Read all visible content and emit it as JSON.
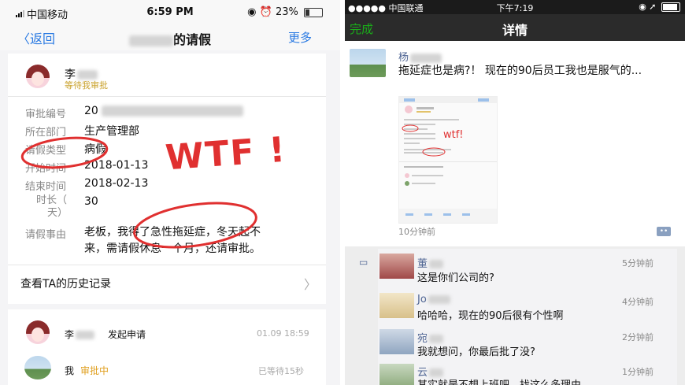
{
  "left": {
    "status": {
      "carrier": "中国移动",
      "time": "6:59 PM",
      "battery": "23%",
      "battery_level": 0.23
    },
    "nav": {
      "back_label": "返回",
      "title_suffix": "的请假",
      "more_label": "更多"
    },
    "applicant": {
      "name": "李",
      "status": "等待我审批"
    },
    "fields": [
      {
        "label": "审批编号",
        "value": "20"
      },
      {
        "label": "所在部门",
        "value": "生产管理部"
      },
      {
        "label": "请假类型",
        "value": "病假"
      },
      {
        "label": "开始时间",
        "value": "2018-01-13"
      },
      {
        "label": "结束时间",
        "value": "2018-02-13"
      },
      {
        "label": "时长（天）",
        "value": "30"
      },
      {
        "label": "请假事由",
        "value": "老板，我得了急性拖延症，冬天起不来，需请假休息一个月，还请审批。"
      }
    ],
    "reason_line1": "老板，我得了急性拖延症，冬天起不",
    "reason_line2": "来，需请假休息一个月，还请审批。",
    "duration_label_line1": "时长（",
    "duration_label_line2": "天）",
    "history_link": "查看TA的历史记录",
    "annotation": "WTF !",
    "flow": [
      {
        "name": "李",
        "action": "发起申请",
        "time": "01.09 18:59"
      },
      {
        "name": "我",
        "action": "审批中",
        "time": "已等待15秒"
      }
    ]
  },
  "right": {
    "status": {
      "carrier": "中国联通",
      "time": "下午7:19"
    },
    "nav": {
      "done_label": "完成",
      "title": "详情"
    },
    "post": {
      "author": "杨",
      "text": "拖延症也是病?！ 现在的90后员工我也是服气的...",
      "time": "10分钟前"
    },
    "comments": [
      {
        "name": "董",
        "time": "5分钟前",
        "text": "这是你们公司的?"
      },
      {
        "name": "Jo",
        "time": "4分钟前",
        "text": "哈哈哈，现在的90后很有个性啊"
      },
      {
        "name": "宛",
        "time": "2分钟前",
        "text": "我就想问，你最后批了没?"
      },
      {
        "name": "云",
        "time": "1分钟前",
        "text": "其实就是不想上班吧，找这么多理由"
      }
    ]
  },
  "colors": {
    "accent_blue": "#2a7ae2",
    "wechat_green": "#1aad19",
    "annotation_red": "#e03030",
    "pending_gold": "#c9a12b",
    "link_name": "#4f6593"
  }
}
